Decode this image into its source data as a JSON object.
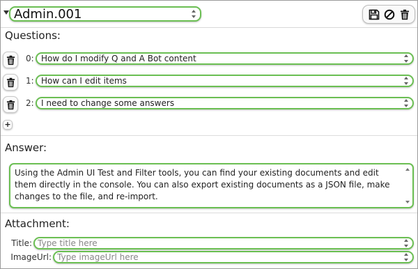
{
  "header": {
    "title": "Admin.001"
  },
  "toolbar": {
    "save_icon": "floppy-disk-icon",
    "disable_icon": "prohibited-icon",
    "delete_icon": "trash-icon"
  },
  "questions": {
    "label": "Questions:",
    "items": [
      {
        "index": "0:",
        "text": "How do I modify Q and A Bot content"
      },
      {
        "index": "1:",
        "text": "How can I edit items"
      },
      {
        "index": "2:",
        "text": "I need to change some answers"
      }
    ],
    "add_label": "+"
  },
  "answer": {
    "label": "Answer:",
    "text": "Using the Admin UI Test and Filter tools, you can find your existing documents and edit them directly in the console. You can also export existing documents as a JSON file, make changes to the file, and re-import."
  },
  "attachment": {
    "label": "Attachment:",
    "title_label": "Title:",
    "title_placeholder": "Type title here",
    "image_label": "ImageUrl:",
    "image_placeholder": "Type imageUrl here"
  },
  "colors": {
    "field_border": "#6bbf53"
  }
}
